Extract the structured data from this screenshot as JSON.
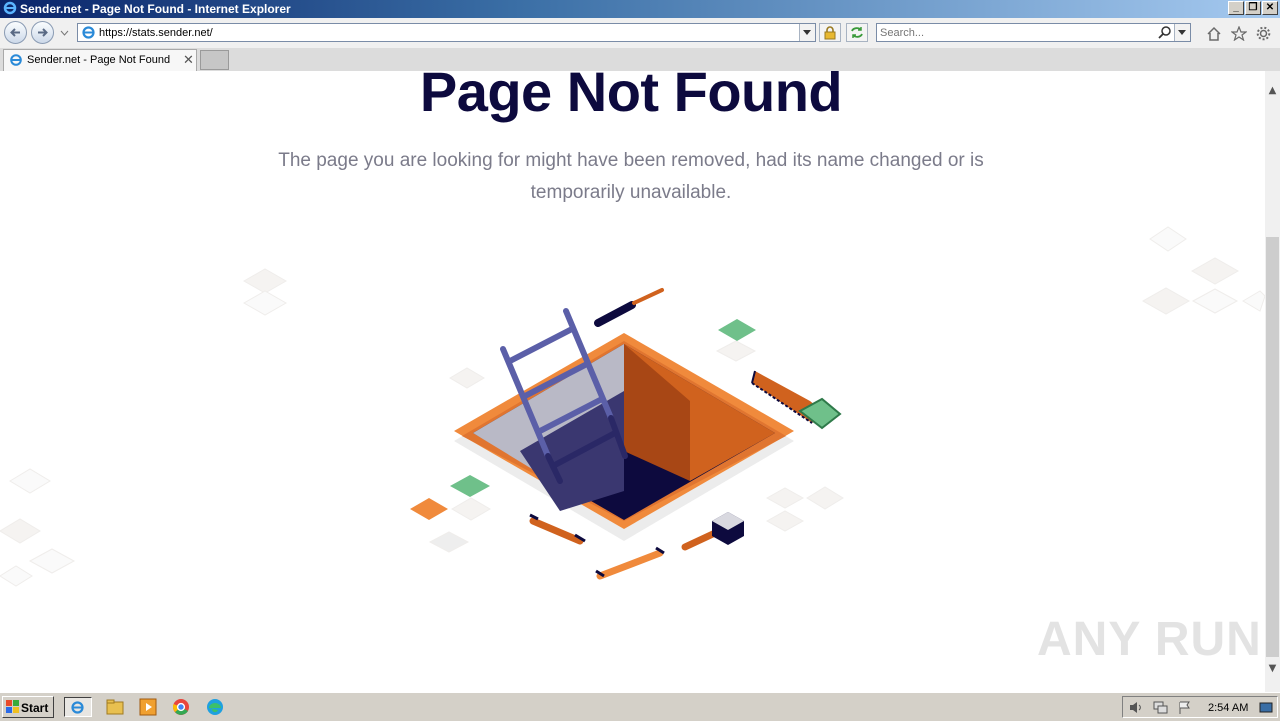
{
  "window": {
    "title": "Sender.net - Page Not Found - Internet Explorer"
  },
  "toolbar": {
    "url": "https://stats.sender.net/",
    "search_placeholder": "Search..."
  },
  "tabs": [
    {
      "label": "Sender.net - Page Not Found"
    }
  ],
  "page": {
    "heading": "Page Not Found",
    "message": "The page you are looking for might have been removed, had its name changed or is temporarily unavailable."
  },
  "watermark": "ANY RUN",
  "taskbar": {
    "start_label": "Start",
    "clock": "2:54 AM"
  },
  "colors": {
    "accent_orange": "#f08a3c",
    "navy": "#0d0a3e",
    "green": "#6fc08a",
    "ladder": "#5b5fa8"
  }
}
